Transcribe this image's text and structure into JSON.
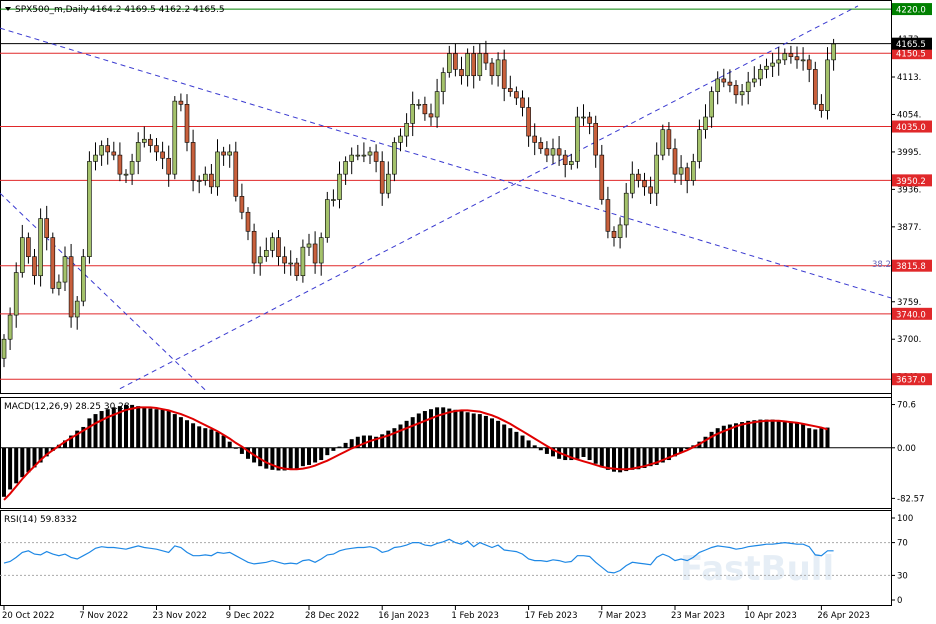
{
  "chart_data": [
    {
      "type": "candlestick",
      "header": {
        "symbol_line": "SPX500_m,Daily",
        "ohlc": "4164.2 4169.5 4162.2 4165.5"
      },
      "yticks": [
        "4173.",
        "4113.",
        "4054.",
        "3995.",
        "3936.",
        "3877.",
        "3818.",
        "3759.",
        "3700.",
        "3641."
      ],
      "ytick_values": [
        4173,
        4113,
        4054,
        3995,
        3936,
        3877,
        3818,
        3759,
        3700,
        3641
      ],
      "ylim": [
        3620,
        4228
      ],
      "xticks": [
        "20 Oct 2022",
        "7 Nov 2022",
        "23 Nov 2022",
        "9 Dec 2022",
        "28 Dec 2022",
        "16 Jan 2023",
        "1 Feb 2023",
        "17 Feb 2023",
        "7 Mar 2023",
        "23 Mar 2023",
        "10 Apr 2023",
        "26 Apr 2023"
      ],
      "xtick_index": [
        0,
        13,
        25,
        37,
        50,
        62,
        74,
        86,
        98,
        110,
        122,
        134
      ],
      "current_price": {
        "value": 4165.5,
        "label": "4165.5"
      },
      "levels": [
        {
          "value": 4220.0,
          "label": "4220.0",
          "color": "#008000"
        },
        {
          "value": 4150.5,
          "label": "4150.5",
          "color": "#e0282a"
        },
        {
          "value": 4035.0,
          "label": "4035.0",
          "color": "#e0282a"
        },
        {
          "value": 3950.2,
          "label": "3950.2",
          "color": "#e0282a"
        },
        {
          "value": 3815.8,
          "label": "3815.8",
          "color": "#e0282a"
        },
        {
          "value": 3740.0,
          "label": "3740.0",
          "color": "#e0282a"
        },
        {
          "value": 3637.0,
          "label": "3637.0",
          "color": "#e0282a"
        }
      ],
      "fib_label": "38.2",
      "colors": {
        "bull": "#a4c26b",
        "bear": "#c8603c",
        "level": "#e0282a",
        "trend": "#3a3ad0"
      },
      "close": [
        3700,
        3738,
        3805,
        3860,
        3830,
        3800,
        3890,
        3860,
        3780,
        3790,
        3830,
        3735,
        3760,
        3830,
        3980,
        3990,
        4005,
        3995,
        3990,
        3960,
        3960,
        3980,
        4010,
        4015,
        4005,
        3995,
        3985,
        3960,
        4075,
        4070,
        4010,
        3950,
        3950,
        3960,
        3940,
        3995,
        3990,
        3995,
        3925,
        3900,
        3870,
        3820,
        3830,
        3840,
        3860,
        3830,
        3820,
        3820,
        3800,
        3845,
        3850,
        3820,
        3860,
        3920,
        3920,
        3960,
        3980,
        3990,
        3990,
        3990,
        3995,
        3980,
        3930,
        3960,
        4010,
        4020,
        4040,
        4070,
        4070,
        4055,
        4050,
        4090,
        4120,
        4150,
        4125,
        4115,
        4150,
        4115,
        4150,
        4135,
        4115,
        4140,
        4095,
        4090,
        4080,
        4065,
        4020,
        4010,
        4000,
        3990,
        4000,
        3990,
        3975,
        3980,
        4050,
        4050,
        4040,
        3990,
        3920,
        3870,
        3860,
        3880,
        3930,
        3960,
        3950,
        3940,
        3930,
        3990,
        4030,
        4000,
        3960,
        3970,
        3950,
        3980,
        4030,
        4050,
        4090,
        4110,
        4105,
        4100,
        4085,
        4090,
        4105,
        4110,
        4125,
        4130,
        4135,
        4140,
        4150,
        4145,
        4140,
        4140,
        4125,
        4070,
        4060,
        4140,
        4165
      ],
      "macd": {
        "label": "MACD(12,26,9) 28.25 30.28",
        "yticks": [
          "70.6",
          "0.00",
          "-82.57"
        ],
        "ylim": [
          -95,
          78
        ],
        "histogram": [
          -80,
          -68,
          -58,
          -48,
          -40,
          -32,
          -24,
          -14,
          -5,
          5,
          12,
          20,
          28,
          34,
          48,
          55,
          60,
          63,
          66,
          68,
          70,
          70,
          68,
          66,
          64,
          63,
          62,
          60,
          55,
          50,
          45,
          40,
          35,
          32,
          30,
          26,
          20,
          10,
          0,
          -10,
          -18,
          -24,
          -30,
          -34,
          -36,
          -37,
          -37,
          -36,
          -34,
          -30,
          -28,
          -24,
          -20,
          -12,
          -5,
          2,
          8,
          14,
          18,
          20,
          20,
          18,
          22,
          28,
          32,
          38,
          44,
          50,
          56,
          60,
          63,
          66,
          66,
          64,
          62,
          60,
          58,
          56,
          55,
          52,
          48,
          44,
          38,
          32,
          26,
          20,
          12,
          4,
          -4,
          -10,
          -14,
          -18,
          -20,
          -20,
          -18,
          -15,
          -20,
          -26,
          -32,
          -36,
          -39,
          -40,
          -38,
          -36,
          -35,
          -33,
          -30,
          -28,
          -24,
          -20,
          -14,
          -8,
          -2,
          4,
          10,
          18,
          26,
          32,
          36,
          38,
          40,
          42,
          44,
          45,
          46,
          46,
          46,
          45,
          44,
          43,
          42,
          38,
          32,
          30,
          32,
          33
        ],
        "signal": [
          -85,
          -75,
          -63,
          -51,
          -40,
          -30,
          -20,
          -11,
          -4,
          3,
          10,
          16,
          22,
          28,
          34,
          40,
          45,
          50,
          54,
          58,
          62,
          64,
          66,
          66,
          66,
          65,
          63,
          61,
          58,
          55,
          51,
          47,
          42,
          37,
          32,
          27,
          21,
          15,
          8,
          2,
          -5,
          -12,
          -18,
          -24,
          -28,
          -32,
          -34,
          -35,
          -35,
          -34,
          -32,
          -29,
          -25,
          -21,
          -16,
          -11,
          -6,
          -1,
          3,
          7,
          11,
          14,
          17,
          20,
          24,
          28,
          32,
          36,
          40,
          44,
          48,
          52,
          55,
          58,
          60,
          61,
          61,
          60,
          59,
          56,
          53,
          49,
          44,
          39,
          33,
          27,
          21,
          15,
          9,
          3,
          -3,
          -8,
          -12,
          -16,
          -19,
          -22,
          -25,
          -28,
          -31,
          -33,
          -34,
          -35,
          -35,
          -34,
          -32,
          -30,
          -27,
          -24,
          -20,
          -16,
          -12,
          -8,
          -4,
          1,
          6,
          12,
          18,
          23,
          27,
          31,
          35,
          38,
          40,
          42,
          43,
          44,
          44,
          44,
          43,
          42,
          41,
          39,
          37,
          35,
          33,
          30
        ]
      },
      "rsi": {
        "label": "RSI(14) 59.8332",
        "yticks": [
          "100",
          "70",
          "30",
          "0"
        ],
        "ylim": [
          0,
          100
        ],
        "levels": [
          70,
          30
        ],
        "values": [
          45,
          47,
          52,
          58,
          60,
          56,
          55,
          59,
          56,
          54,
          56,
          52,
          50,
          54,
          58,
          63,
          65,
          64,
          64,
          63,
          62,
          64,
          66,
          64,
          63,
          62,
          60,
          58,
          66,
          64,
          58,
          54,
          54,
          55,
          54,
          58,
          57,
          58,
          54,
          50,
          46,
          44,
          45,
          46,
          48,
          46,
          44,
          45,
          44,
          48,
          49,
          46,
          50,
          55,
          56,
          60,
          62,
          63,
          64,
          64,
          65,
          63,
          58,
          60,
          64,
          65,
          67,
          70,
          70,
          67,
          66,
          69,
          71,
          74,
          70,
          68,
          72,
          65,
          70,
          67,
          64,
          67,
          61,
          60,
          59,
          56,
          50,
          48,
          48,
          47,
          49,
          48,
          46,
          47,
          54,
          54,
          53,
          46,
          40,
          34,
          33,
          36,
          42,
          46,
          45,
          44,
          43,
          52,
          56,
          53,
          48,
          50,
          48,
          52,
          58,
          61,
          64,
          66,
          65,
          64,
          62,
          63,
          65,
          66,
          67,
          68,
          68,
          69,
          70,
          69,
          68,
          68,
          65,
          55,
          54,
          60,
          60
        ]
      },
      "watermark": "FastBull"
    }
  ]
}
